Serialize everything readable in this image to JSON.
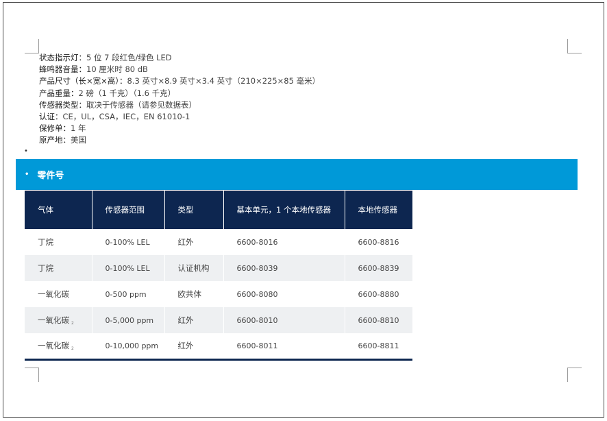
{
  "specs": [
    {
      "label": "状态指示灯：",
      "value": "5 位 7 段红色/绿色 LED"
    },
    {
      "label": "蜂鸣器音量：",
      "value": "10 厘米时 80 dB"
    },
    {
      "label": "产品尺寸（长×宽×高）：",
      "value": "8.3 英寸×8.9 英寸×3.4 英寸（210×225×85 毫米）"
    },
    {
      "label": "产品重量：",
      "value": "2 磅（1 千克）（1.6 千克）"
    },
    {
      "label": "传感器类型：",
      "value": "取决于传感器（请参见数据表）"
    },
    {
      "label": "认证：",
      "value": "CE，UL，CSA，IEC，EN 61010-1"
    },
    {
      "label": "保修单：",
      "value": "1 年"
    },
    {
      "label": "原产地：",
      "value": "美国"
    }
  ],
  "section_title": "零件号",
  "table": {
    "headers": [
      "气体",
      "传感器范围",
      "类型",
      "基本单元，1 个本地传感器",
      "本地传感器"
    ],
    "rows": [
      {
        "gas": "丁烷",
        "sub": "",
        "range": "0-100% LEL",
        "type": "红外",
        "base": "6600-8016",
        "local": "6600-8816"
      },
      {
        "gas": "丁烷",
        "sub": "",
        "range": "0-100% LEL",
        "type": "认证机构",
        "base": "6600-8039",
        "local": "6600-8839"
      },
      {
        "gas": "一氧化碳",
        "sub": "",
        "range": "0-500 ppm",
        "type": "欧共体",
        "base": "6600-8080",
        "local": "6600-8880"
      },
      {
        "gas": "一氧化碳",
        "sub": "2",
        "range": "0-5,000 ppm",
        "type": "红外",
        "base": "6600-8010",
        "local": "6600-8810"
      },
      {
        "gas": "一氧化碳",
        "sub": "2",
        "range": "0-10,000 ppm",
        "type": "红外",
        "base": "6600-8011",
        "local": "6600-8811"
      }
    ]
  },
  "colors": {
    "section_bar": "#0099d8",
    "table_header": "#0d2650",
    "row_alt": "#eef0f2"
  }
}
